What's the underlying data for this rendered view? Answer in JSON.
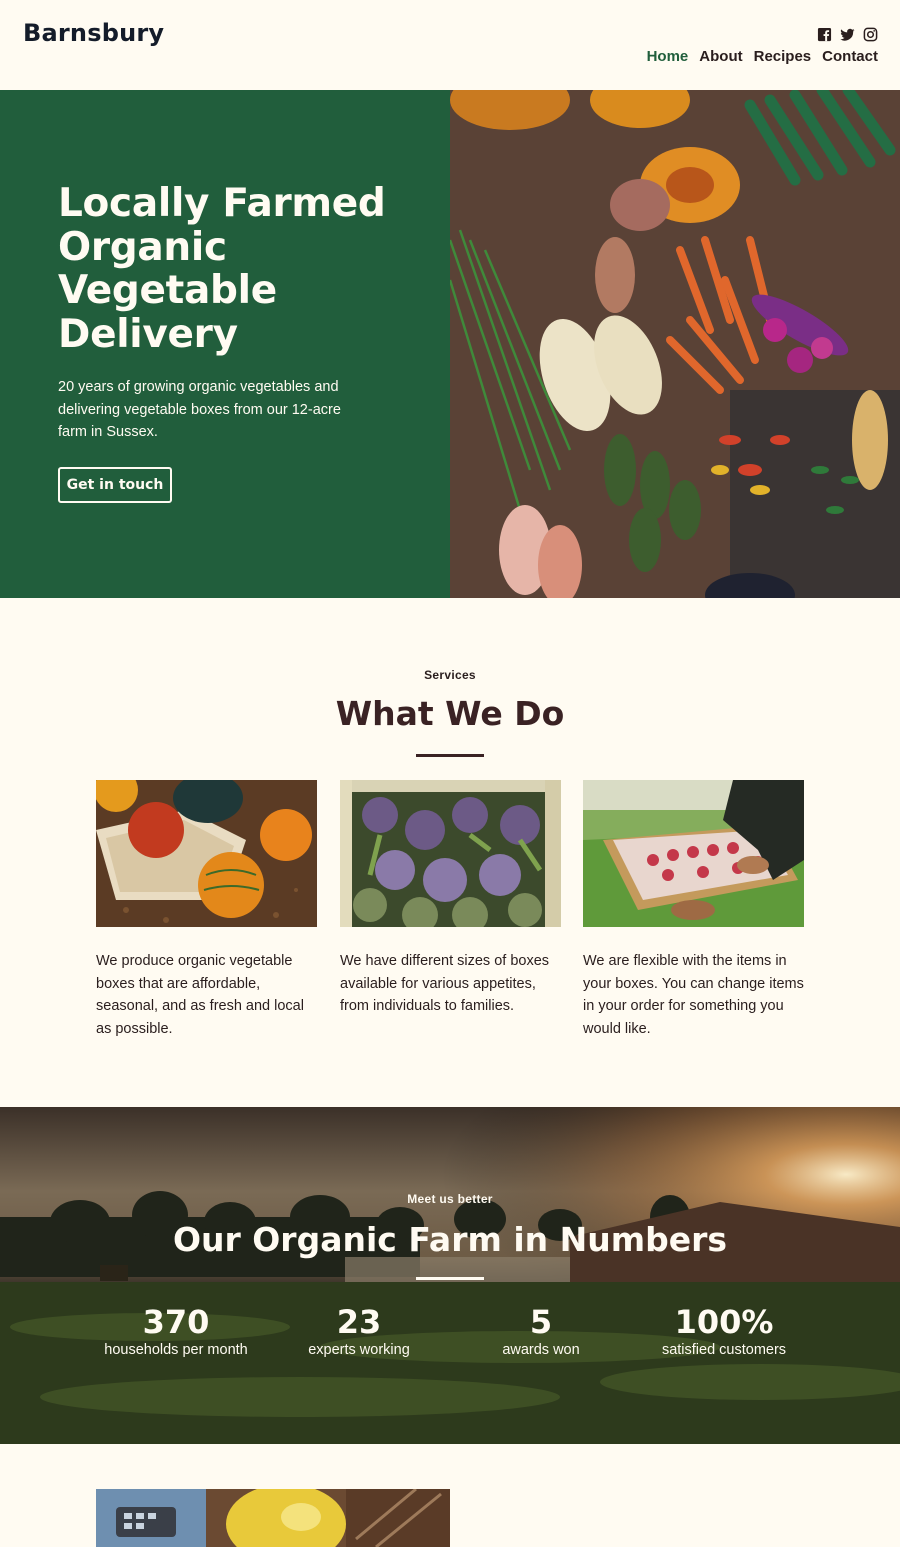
{
  "header": {
    "brand": "Barnsbury",
    "social_icons": [
      "facebook-icon",
      "twitter-icon",
      "instagram-icon"
    ],
    "nav": [
      {
        "label": "Home",
        "active": true
      },
      {
        "label": "About",
        "active": false
      },
      {
        "label": "Recipes",
        "active": false
      },
      {
        "label": "Contact",
        "active": false
      }
    ]
  },
  "hero": {
    "title": "Locally Farmed Organic Vegetable Delivery",
    "text": "20 years of growing organic vegetables and delivering vegetable boxes from our 12-acre farm in Sussex.",
    "button_label": "Get in touch"
  },
  "services": {
    "eyebrow": "Services",
    "title": "What We Do",
    "cards": [
      {
        "text": "We produce organic vegetable boxes that are affordable, seasonal, and as fresh and local as possible."
      },
      {
        "text": "We have different sizes of boxes available for various appetites, from individuals to families."
      },
      {
        "text": "We are flexible with the items in your boxes. You can change items in your order for something you would like."
      }
    ]
  },
  "numbers": {
    "eyebrow": "Meet us better",
    "title": "Our Organic Farm in Numbers",
    "stats": [
      {
        "value": "370",
        "label": "households per month"
      },
      {
        "value": "23",
        "label": "experts working"
      },
      {
        "value": "5",
        "label": "awards won"
      },
      {
        "value": "100%",
        "label": "satisfied customers"
      }
    ]
  },
  "colors": {
    "primary_green": "#215e3c",
    "background": "#fffbf2",
    "text_dark": "#2a1e1e"
  }
}
